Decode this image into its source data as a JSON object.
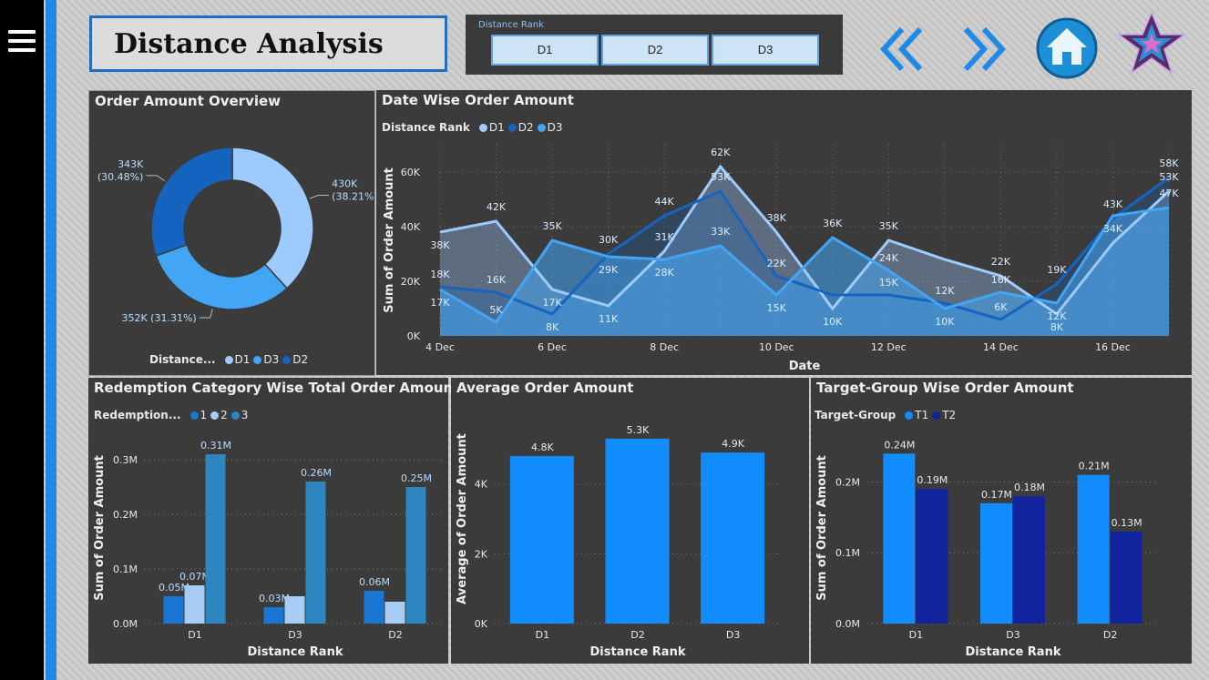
{
  "header": {
    "title": "Distance Analysis",
    "slicer_title": "Distance Rank",
    "slicer_options": [
      "D1",
      "D2",
      "D3"
    ]
  },
  "icons": {
    "menu": "hamburger-menu-icon",
    "prev": "double-chevron-left-icon",
    "next": "double-chevron-right-icon",
    "home": "home-icon",
    "logo": "star-logo-icon"
  },
  "colors": {
    "D1": "#9ecbff",
    "D2": "#1565c0",
    "D3": "#42a5f5",
    "accent": "#1e8ae6",
    "T1": "#118dff",
    "T2": "#12239e",
    "R1": "#1976d2",
    "R2": "#a8cdf5",
    "R3": "#2e86c1",
    "avg_bar": "#118dff"
  },
  "panels": {
    "overview": {
      "title": "Order Amount Overview",
      "legend_title": "Distance...",
      "legend": [
        "D1",
        "D3",
        "D2"
      ]
    },
    "datewise": {
      "title": "Date Wise Order Amount",
      "legend_title": "Distance Rank",
      "legend": [
        "D1",
        "D2",
        "D3"
      ]
    },
    "redemption": {
      "title": "Redemption Category Wise Total Order Amount",
      "legend_title": "Redemption...",
      "legend": [
        "1",
        "2",
        "3"
      ]
    },
    "average": {
      "title": "Average Order Amount"
    },
    "target": {
      "title": "Target-Group Wise Order Amount",
      "legend_title": "Target-Group",
      "legend": [
        "T1",
        "T2"
      ]
    }
  },
  "chart_data": [
    {
      "id": "donut",
      "type": "pie",
      "title": "Order Amount Overview",
      "slices": [
        {
          "name": "D1",
          "value": 430,
          "label": "430K",
          "pct": "(38.21%)"
        },
        {
          "name": "D3",
          "value": 352,
          "label": "352K (31.31%)",
          "pct": ""
        },
        {
          "name": "D2",
          "value": 343,
          "label": "343K",
          "pct": "(30.48%)"
        }
      ]
    },
    {
      "id": "line",
      "type": "area",
      "title": "Date Wise Order Amount",
      "xlabel": "Date",
      "ylabel": "Sum of Order Amount",
      "ylim": [
        0,
        70
      ],
      "yticks": [
        0,
        20,
        40,
        60
      ],
      "ytick_labels": [
        "0K",
        "20K",
        "40K",
        "60K"
      ],
      "x": [
        "4 Dec",
        "5 Dec",
        "6 Dec",
        "7 Dec",
        "8 Dec",
        "9 Dec",
        "10 Dec",
        "11 Dec",
        "12 Dec",
        "13 Dec",
        "14 Dec",
        "15 Dec",
        "16 Dec",
        "17 Dec"
      ],
      "xtick_labels": [
        "4 Dec",
        "6 Dec",
        "8 Dec",
        "10 Dec",
        "12 Dec",
        "14 Dec",
        "16 Dec"
      ],
      "series": [
        {
          "name": "D1",
          "values": [
            38,
            42,
            17,
            11,
            31,
            62,
            38,
            10,
            35,
            28,
            22,
            8,
            34,
            53
          ]
        },
        {
          "name": "D2",
          "values": [
            18,
            16,
            8,
            30,
            44,
            53,
            22,
            15,
            15,
            12,
            6,
            19,
            43,
            58
          ]
        },
        {
          "name": "D3",
          "values": [
            17,
            5,
            35,
            29,
            28,
            33,
            15,
            36,
            24,
            10,
            16,
            12,
            44,
            47
          ]
        }
      ],
      "data_labels": [
        {
          "text": "38K",
          "x": 0,
          "y": 38,
          "dy": 18
        },
        {
          "text": "42K",
          "x": 1,
          "y": 42,
          "dy": -12
        },
        {
          "text": "17K",
          "x": 2,
          "y": 17,
          "dy": 18
        },
        {
          "text": "11K",
          "x": 3,
          "y": 11,
          "dy": 18
        },
        {
          "text": "31K",
          "x": 4,
          "y": 31,
          "dy": -12
        },
        {
          "text": "62K",
          "x": 5,
          "y": 62,
          "dy": -12
        },
        {
          "text": "38K",
          "x": 6,
          "y": 38,
          "dy": -12
        },
        {
          "text": "10K",
          "x": 7,
          "y": 10,
          "dy": 18
        },
        {
          "text": "35K",
          "x": 8,
          "y": 35,
          "dy": -12
        },
        {
          "text": "22K",
          "x": 10,
          "y": 22,
          "dy": -12
        },
        {
          "text": "8K",
          "x": 11,
          "y": 8,
          "dy": 18
        },
        {
          "text": "34K",
          "x": 12,
          "y": 34,
          "dy": -12
        },
        {
          "text": "53K",
          "x": 13,
          "y": 53,
          "dy": -12
        },
        {
          "text": "18K",
          "x": 0,
          "y": 18,
          "dy": -10
        },
        {
          "text": "16K",
          "x": 1,
          "y": 16,
          "dy": -10
        },
        {
          "text": "8K",
          "x": 2,
          "y": 8,
          "dy": 18
        },
        {
          "text": "30K",
          "x": 3,
          "y": 30,
          "dy": -12
        },
        {
          "text": "44K",
          "x": 4,
          "y": 44,
          "dy": -12
        },
        {
          "text": "53K",
          "x": 5,
          "y": 53,
          "dy": -12
        },
        {
          "text": "22K",
          "x": 6,
          "y": 22,
          "dy": -10
        },
        {
          "text": "15K",
          "x": 8,
          "y": 15,
          "dy": -10
        },
        {
          "text": "12K",
          "x": 9,
          "y": 12,
          "dy": -10
        },
        {
          "text": "6K",
          "x": 10,
          "y": 6,
          "dy": -10
        },
        {
          "text": "19K",
          "x": 11,
          "y": 19,
          "dy": -12
        },
        {
          "text": "43K",
          "x": 12,
          "y": 43,
          "dy": -12
        },
        {
          "text": "58K",
          "x": 13,
          "y": 58,
          "dy": -12
        },
        {
          "text": "17K",
          "x": 0,
          "y": 17,
          "dy": 18
        },
        {
          "text": "5K",
          "x": 1,
          "y": 5,
          "dy": -10
        },
        {
          "text": "35K",
          "x": 2,
          "y": 35,
          "dy": -12
        },
        {
          "text": "29K",
          "x": 3,
          "y": 29,
          "dy": 18
        },
        {
          "text": "28K",
          "x": 4,
          "y": 28,
          "dy": 18
        },
        {
          "text": "33K",
          "x": 5,
          "y": 33,
          "dy": -12
        },
        {
          "text": "15K",
          "x": 6,
          "y": 15,
          "dy": 18
        },
        {
          "text": "36K",
          "x": 7,
          "y": 36,
          "dy": -12
        },
        {
          "text": "24K",
          "x": 8,
          "y": 24,
          "dy": -10
        },
        {
          "text": "10K",
          "x": 9,
          "y": 10,
          "dy": 18
        },
        {
          "text": "16K",
          "x": 10,
          "y": 16,
          "dy": -10
        },
        {
          "text": "12K",
          "x": 11,
          "y": 12,
          "dy": 18
        },
        {
          "text": "47K",
          "x": 13,
          "y": 47,
          "dy": -12
        }
      ]
    },
    {
      "id": "redemption",
      "type": "bar",
      "title": "Redemption Category Wise Total Order Amount",
      "xlabel": "Distance Rank",
      "ylabel": "Sum of Order Amount",
      "categories": [
        "D1",
        "D3",
        "D2"
      ],
      "ylim": [
        0,
        0.35
      ],
      "yticks": [
        0,
        0.1,
        0.2,
        0.3
      ],
      "ytick_labels": [
        "0.0M",
        "0.1M",
        "0.2M",
        "0.3M"
      ],
      "series": [
        {
          "name": "1",
          "values": [
            0.05,
            0.03,
            0.06
          ],
          "labels": [
            "0.05M",
            "0.03M",
            "0.06M"
          ]
        },
        {
          "name": "2",
          "values": [
            0.07,
            0.05,
            0.04
          ],
          "labels": [
            "0.07M",
            "",
            ""
          ]
        },
        {
          "name": "3",
          "values": [
            0.31,
            0.26,
            0.25
          ],
          "labels": [
            "0.31M",
            "0.26M",
            "0.25M"
          ]
        }
      ]
    },
    {
      "id": "average",
      "type": "bar",
      "title": "Average Order Amount",
      "xlabel": "Distance Rank",
      "ylabel": "Average of Order Amount",
      "categories": [
        "D1",
        "D2",
        "D3"
      ],
      "ylim": [
        0,
        6
      ],
      "yticks": [
        0,
        2,
        4
      ],
      "ytick_labels": [
        "0K",
        "2K",
        "4K"
      ],
      "series": [
        {
          "name": "Average of Order Amount",
          "values": [
            4.8,
            5.3,
            4.9
          ],
          "labels": [
            "4.8K",
            "5.3K",
            "4.9K"
          ]
        }
      ]
    },
    {
      "id": "target",
      "type": "bar",
      "title": "Target-Group Wise Order Amount",
      "xlabel": "Distance Rank",
      "ylabel": "Sum of Order Amount",
      "categories": [
        "D1",
        "D3",
        "D2"
      ],
      "ylim": [
        0,
        0.27
      ],
      "yticks": [
        0,
        0.1,
        0.2
      ],
      "ytick_labels": [
        "0.0M",
        "0.1M",
        "0.2M"
      ],
      "series": [
        {
          "name": "T1",
          "values": [
            0.24,
            0.17,
            0.21
          ],
          "labels": [
            "0.24M",
            "0.17M",
            "0.21M"
          ]
        },
        {
          "name": "T2",
          "values": [
            0.19,
            0.18,
            0.13
          ],
          "labels": [
            "0.19M",
            "0.18M",
            "0.13M"
          ]
        }
      ]
    }
  ]
}
